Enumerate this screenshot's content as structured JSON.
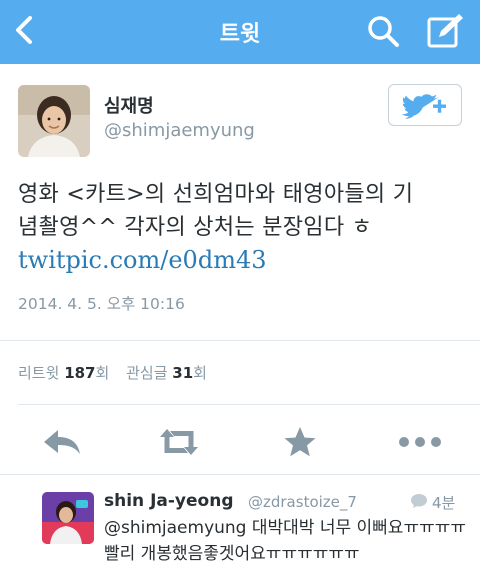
{
  "nav": {
    "title": "트윗",
    "back_icon": "chevron-left-icon",
    "search_icon": "search-icon",
    "compose_icon": "compose-icon",
    "bar_color": "#55acee"
  },
  "tweet": {
    "author_name": "심재명",
    "author_handle": "@shimjaemyung",
    "follow_icon": "follow-bird-plus-icon",
    "text_line1": "영화 <카트>의 선희엄마와 태영아들의 기",
    "text_line2": "념촬영^^ 각자의 상처는 분장임다 ㅎ",
    "link": "twitpic.com/e0dm43",
    "timestamp": "2014. 4. 5. 오후 10:16",
    "link_color": "#2a7bb5"
  },
  "stats": {
    "retweets_label": "리트윗",
    "retweets_count": "187",
    "retweets_unit": "회",
    "favorites_label": "관심글",
    "favorites_count": "31",
    "favorites_unit": "회"
  },
  "actions": {
    "reply_icon": "reply-icon",
    "retweet_icon": "retweet-icon",
    "favorite_icon": "star-icon",
    "more_icon": "more-dots-icon"
  },
  "reply": {
    "name": "shin Ja-yeong",
    "handle": "@zdrastoize_7",
    "time": "4분",
    "text": "@shimjaemyung 대박대박 너무 이뻐요ㅠㅠㅠㅠ 빨리 개봉했음좋겟어요ㅠㅠㅠㅠㅠㅠ"
  }
}
